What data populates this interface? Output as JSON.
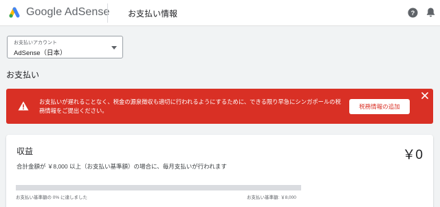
{
  "header": {
    "brand": "Google AdSense",
    "page_title": "お支払い情報",
    "icons": [
      "adsense-logo-icon",
      "help-icon",
      "bell-icon"
    ]
  },
  "account_select": {
    "label": "お支払いアカウント",
    "value": "AdSense（日本）"
  },
  "section_title": "お支払い",
  "alert": {
    "message": "お支払いが遅れることなく、税金の源泉徴収も適切に行われるようにするために、できる限り早急にシンガポールの税務情報をご提出ください。",
    "action_label": "税務情報の追加",
    "color": "#d93025"
  },
  "earnings": {
    "title": "収益",
    "amount": "￥0",
    "description": "合計金額が ￥8,000 以上（お支払い基準額）の場合に、毎月支払いが行われます",
    "progress_percent": 0,
    "progress_left_label": "お支払い基準額の 0% に達しました",
    "progress_right_label": "お支払い基準額: ￥8,000"
  },
  "colors": {
    "accent": "#1a73e8",
    "alert_red": "#d93025",
    "logo_yellow": "#fbbc04",
    "logo_blue": "#4285f4",
    "logo_green": "#34a853"
  }
}
